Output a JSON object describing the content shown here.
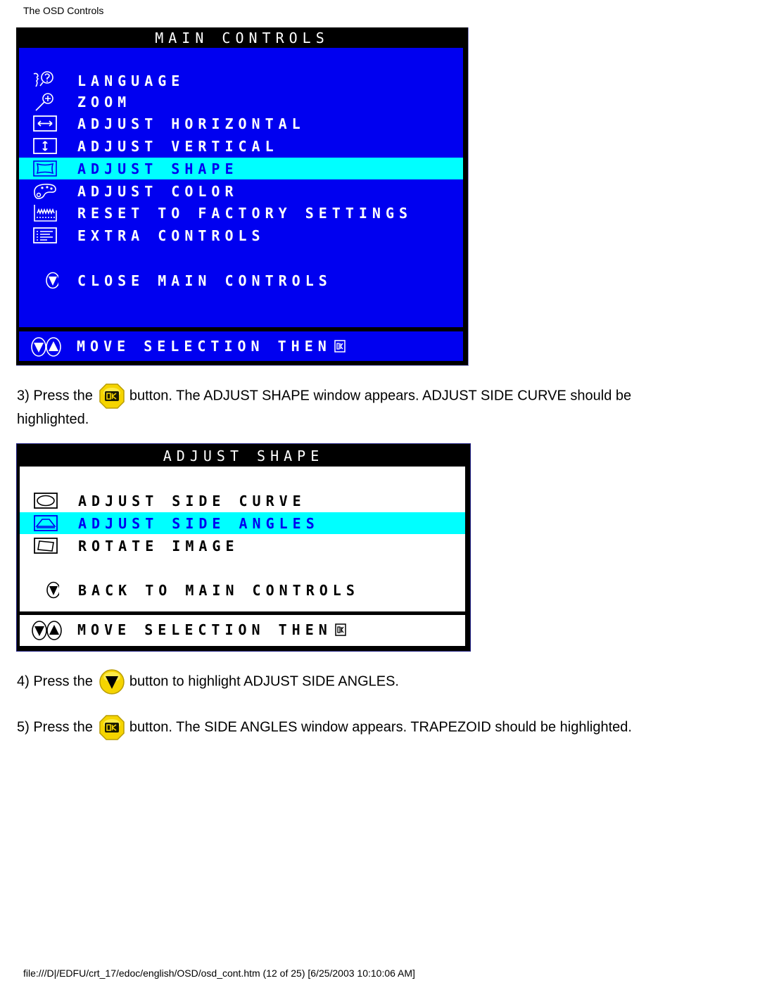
{
  "page": {
    "header": "The OSD Controls",
    "footer": "file:///D|/EDFU/crt_17/edoc/english/OSD/osd_cont.htm (12 of 25) [6/25/2003 10:10:06 AM]"
  },
  "main_controls": {
    "title": "MAIN CONTROLS",
    "colors": {
      "background": "#0000f0",
      "highlight": "#00ffff",
      "text": "#ffffff",
      "title_bar": "#000000"
    },
    "items": [
      {
        "icon": "language-icon",
        "label": "LANGUAGE",
        "selected": false
      },
      {
        "icon": "zoom-icon",
        "label": "ZOOM",
        "selected": false
      },
      {
        "icon": "adjust-horizontal-icon",
        "label": "ADJUST HORIZONTAL",
        "selected": false
      },
      {
        "icon": "adjust-vertical-icon",
        "label": "ADJUST VERTICAL",
        "selected": false
      },
      {
        "icon": "adjust-shape-icon",
        "label": "ADJUST SHAPE",
        "selected": true
      },
      {
        "icon": "adjust-color-icon",
        "label": "ADJUST COLOR",
        "selected": false
      },
      {
        "icon": "factory-reset-icon",
        "label": "RESET TO FACTORY SETTINGS",
        "selected": false
      },
      {
        "icon": "extra-controls-icon",
        "label": "EXTRA CONTROLS",
        "selected": false
      }
    ],
    "close_item": {
      "icon": "down-arrow-icon",
      "label": "CLOSE MAIN CONTROLS"
    },
    "footer": {
      "label": "MOVE SELECTION THEN",
      "icons": [
        "down-arrow-icon",
        "up-arrow-icon",
        "ok-icon"
      ]
    }
  },
  "step3": {
    "prefix": "3) Press the",
    "button": "ok-button",
    "text": "button. The ADJUST SHAPE window appears. ADJUST SIDE CURVE should be",
    "text_line2": "highlighted."
  },
  "adjust_shape": {
    "title": "ADJUST SHAPE",
    "colors": {
      "background": "#ffffff",
      "highlight": "#00ffff",
      "text": "#000000",
      "selected_text": "#0000f0"
    },
    "items": [
      {
        "icon": "side-curve-icon",
        "label": "ADJUST SIDE CURVE",
        "selected": false
      },
      {
        "icon": "side-angles-icon",
        "label": "ADJUST SIDE ANGLES",
        "selected": true
      },
      {
        "icon": "rotate-image-icon",
        "label": "ROTATE IMAGE",
        "selected": false
      }
    ],
    "back_item": {
      "icon": "down-arrow-icon",
      "label": "BACK TO MAIN CONTROLS"
    },
    "footer": {
      "label": "MOVE SELECTION THEN",
      "icons": [
        "down-arrow-icon",
        "up-arrow-icon",
        "ok-icon"
      ]
    }
  },
  "step4": {
    "prefix": "4) Press the",
    "button": "down-button",
    "text": "button to highlight ADJUST SIDE ANGLES."
  },
  "step5": {
    "prefix": "5) Press the",
    "button": "ok-button",
    "text": "button. The SIDE ANGLES window appears. TRAPEZOID should be highlighted."
  }
}
